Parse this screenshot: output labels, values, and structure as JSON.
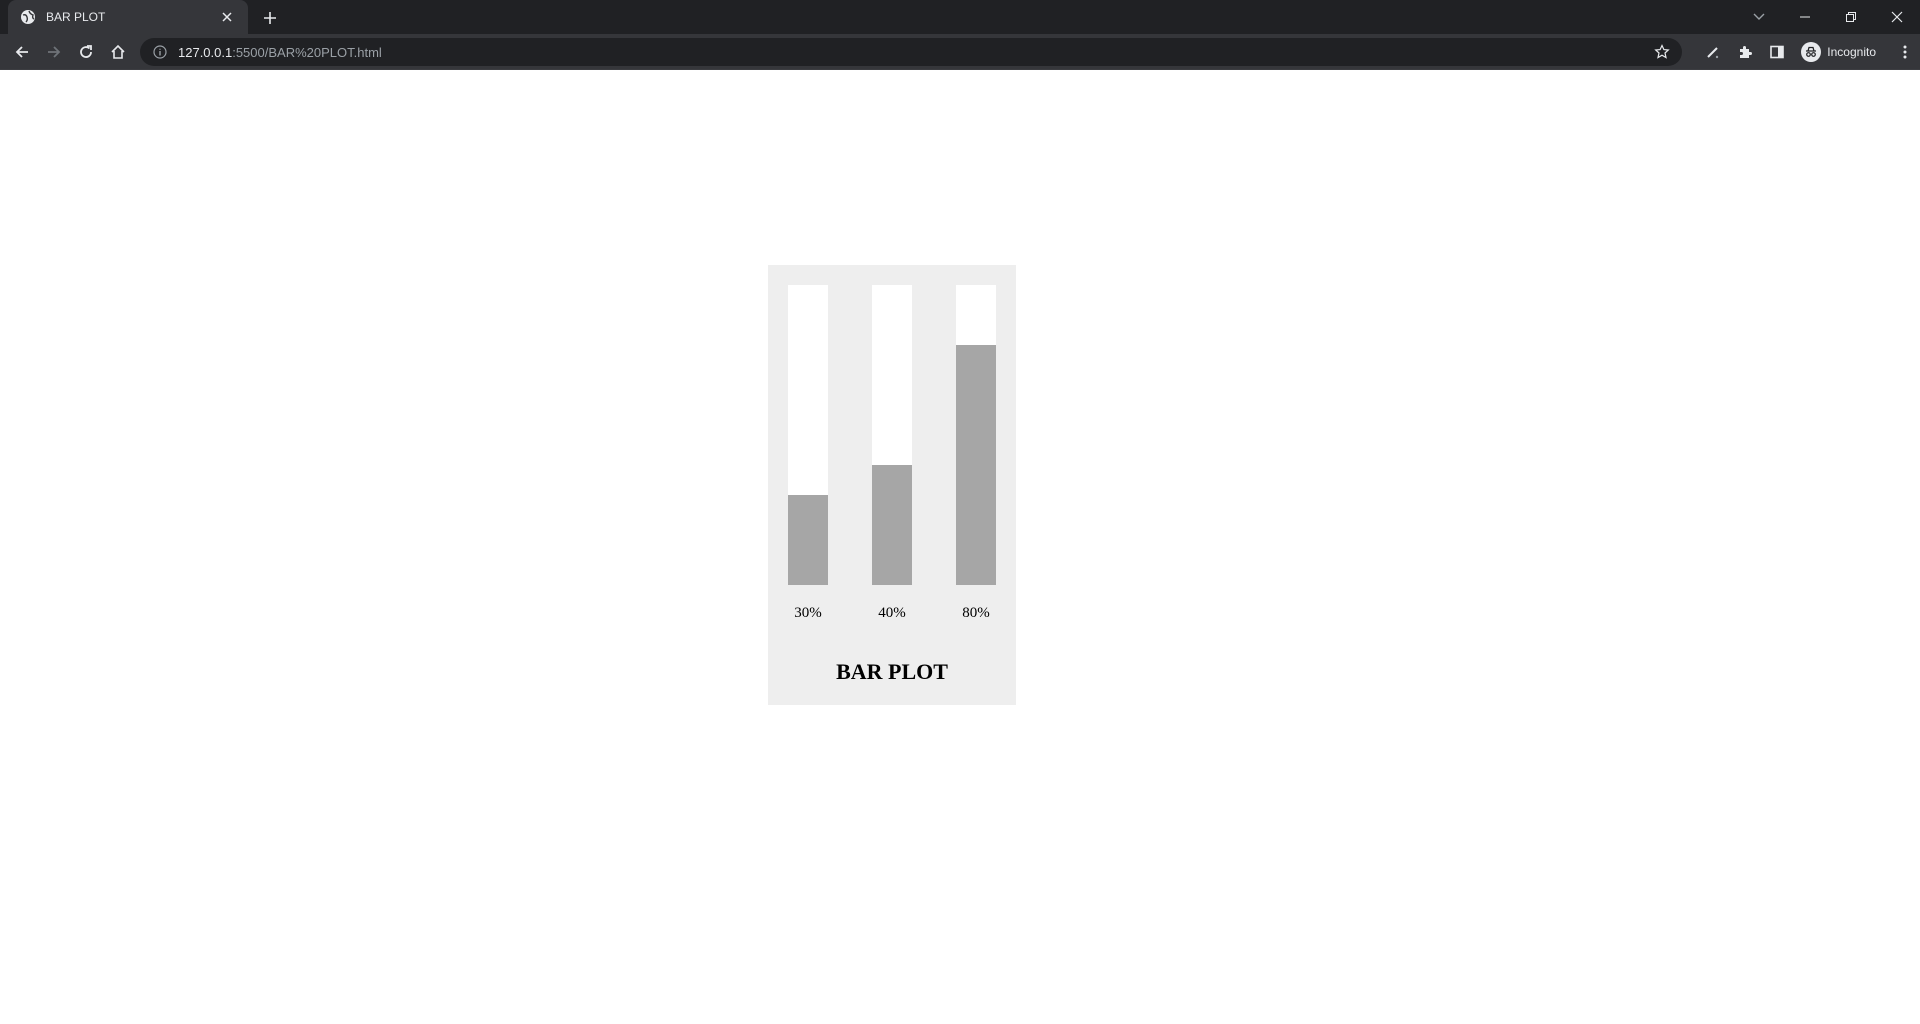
{
  "browser": {
    "tab": {
      "title": "BAR PLOT"
    },
    "url": {
      "host": "127.0.0.1",
      "rest": ":5500/BAR%20PLOT.html"
    },
    "profile_label": "Incognito",
    "icons": [
      "globe-icon",
      "close-icon",
      "plus-icon",
      "chevron-down-icon",
      "minimize-icon",
      "restore-icon",
      "back-icon",
      "forward-icon",
      "reload-icon",
      "home-icon",
      "info-icon",
      "star-icon",
      "pen-icon",
      "puzzle-icon",
      "side-panel-icon",
      "incognito-icon",
      "kebab-menu-icon"
    ]
  },
  "colors": {
    "chrome_dark": "#202124",
    "chrome_mid": "#35363a",
    "card_bg": "#eeeeee",
    "bar_track": "#ffffff",
    "bar_fill": "#a6a6a6"
  },
  "chart_data": {
    "type": "bar",
    "title": "BAR PLOT",
    "categories": [
      "30%",
      "40%",
      "80%"
    ],
    "values": [
      30,
      40,
      80
    ],
    "ylim": [
      0,
      100
    ],
    "grid": false,
    "xlabel": "",
    "ylabel": ""
  }
}
